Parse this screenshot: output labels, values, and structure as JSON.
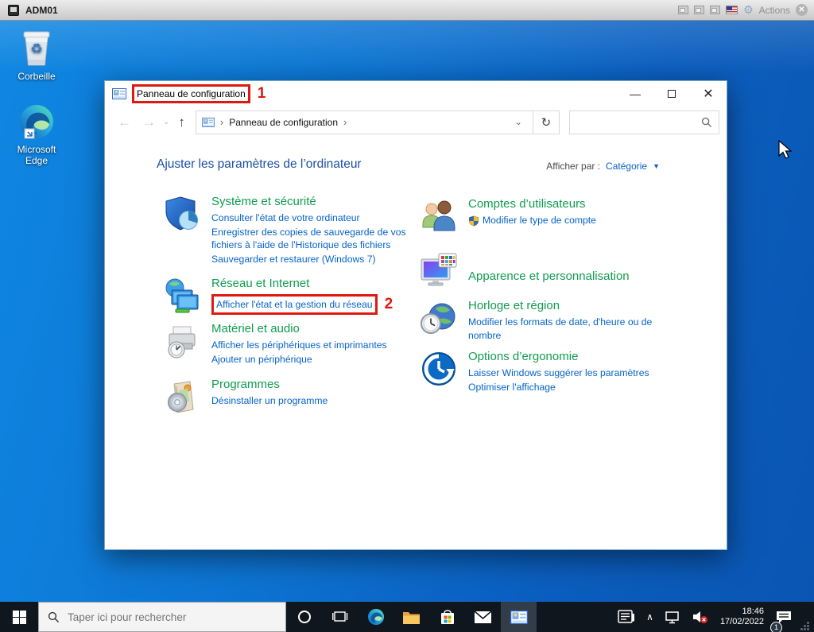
{
  "colors": {
    "annotation_red": "#df1810",
    "category_title_green": "#0f9d4f",
    "link_blue": "#0663c7",
    "heading_blue": "#1d4fa5",
    "desktop_blue": "#0d74d2",
    "taskbar_dark": "#10161e"
  },
  "vm": {
    "title": "ADM01",
    "actions_label": "Actions"
  },
  "desktop": {
    "icons": [
      {
        "label": "Corbeille"
      },
      {
        "label": "Microsoft Edge"
      }
    ]
  },
  "annotations": {
    "n1": "1",
    "n2": "2"
  },
  "window": {
    "title": "Panneau de configuration",
    "breadcrumb": {
      "sep1": "›",
      "path": "Panneau de configuration",
      "sep2": "›"
    },
    "heading": "Ajuster les paramètres de l’ordinateur",
    "view_by_label": "Afficher par :",
    "view_by_value": "Catégorie",
    "categories": [
      {
        "title": "Système et sécurité",
        "links": [
          "Consulter l'état de votre ordinateur",
          "Enregistrer des copies de sauvegarde de vos fichiers à l'aide de l'Historique des fichiers",
          "Sauvegarder et restaurer (Windows 7)"
        ]
      },
      {
        "title": "Réseau et Internet",
        "links": [
          "Afficher l'état et la gestion du réseau"
        ]
      },
      {
        "title": "Matériel et audio",
        "links": [
          "Afficher les périphériques et imprimantes",
          "Ajouter un périphérique"
        ]
      },
      {
        "title": "Programmes",
        "links": [
          "Désinstaller un programme"
        ]
      },
      {
        "title": "Comptes d’utilisateurs",
        "links": [
          "Modifier le type de compte"
        ]
      },
      {
        "title": "Apparence et personnalisation",
        "links": []
      },
      {
        "title": "Horloge et région",
        "links": [
          "Modifier les formats de date, d'heure ou de nombre"
        ]
      },
      {
        "title": "Options d’ergonomie",
        "links": [
          "Laisser Windows suggérer les paramètres",
          "Optimiser l'affichage"
        ]
      }
    ]
  },
  "taskbar": {
    "search_placeholder": "Taper ici pour rechercher",
    "time": "18:46",
    "date": "17/02/2022",
    "notification_badge": "1"
  }
}
